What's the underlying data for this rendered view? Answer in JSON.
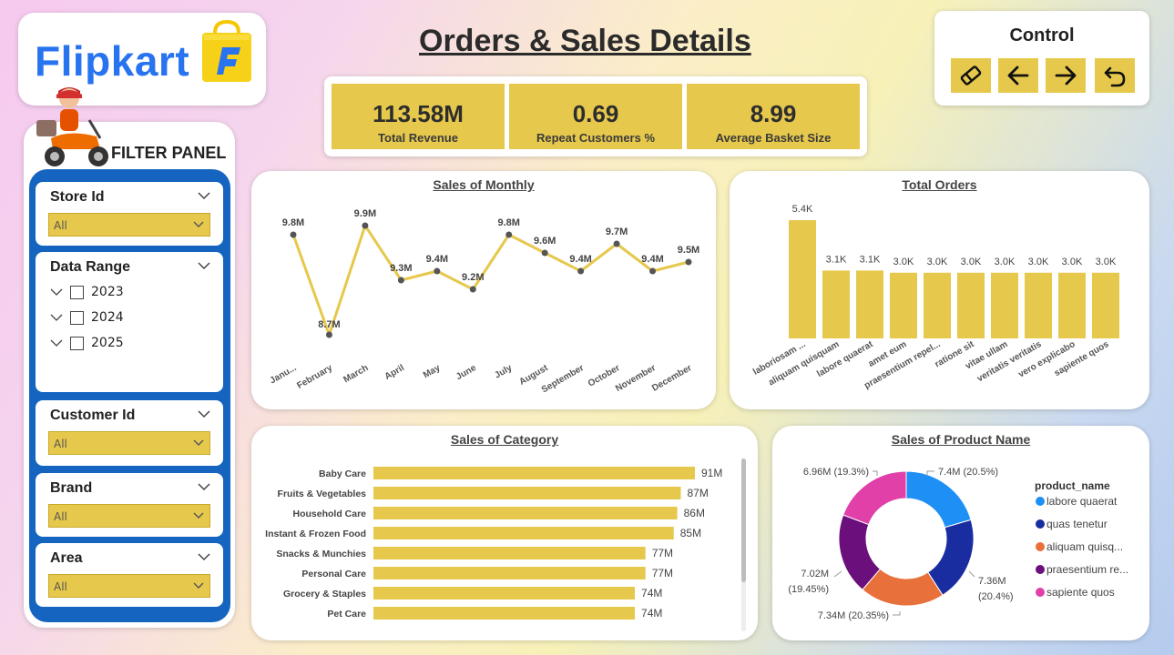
{
  "brand": {
    "name": "Flipkart"
  },
  "page_title": "Orders & Sales Details",
  "control": {
    "title": "Control",
    "buttons": [
      {
        "id": "eraser",
        "icon": "eraser-icon"
      },
      {
        "id": "back",
        "icon": "arrow-left-icon"
      },
      {
        "id": "forward",
        "icon": "arrow-right-icon"
      },
      {
        "id": "reset",
        "icon": "undo-icon"
      }
    ]
  },
  "kpis": [
    {
      "value": "113.58M",
      "label": "Total Revenue"
    },
    {
      "value": "0.69",
      "label": "Repeat Customers %"
    },
    {
      "value": "8.99",
      "label": "Average Basket Size"
    }
  ],
  "filter_panel": {
    "title": "FILTER PANEL",
    "store": {
      "title": "Store Id",
      "value": "All"
    },
    "date_range": {
      "title": "Data Range",
      "years": [
        "2023",
        "2024",
        "2025"
      ]
    },
    "customer": {
      "title": "Customer Id",
      "value": "All"
    },
    "brand": {
      "title": "Brand",
      "value": "All"
    },
    "area": {
      "title": "Area",
      "value": "All"
    }
  },
  "colors": {
    "accent": "#e6c84c",
    "panel_blue": "#1565c0",
    "bar": "#e6c84c",
    "line": "#e6c84c"
  },
  "chart_data": [
    {
      "type": "line",
      "title": "Sales of Monthly",
      "categories": [
        "Janu...",
        "February",
        "March",
        "April",
        "May",
        "June",
        "July",
        "August",
        "September",
        "October",
        "November",
        "December"
      ],
      "values": [
        9.8,
        8.7,
        9.9,
        9.3,
        9.4,
        9.2,
        9.8,
        9.6,
        9.4,
        9.7,
        9.4,
        9.5
      ],
      "labels": [
        "9.8M",
        "8.7M",
        "9.9M",
        "9.3M",
        "9.4M",
        "9.2M",
        "9.8M",
        "9.6M",
        "9.4M",
        "9.7M",
        "9.4M",
        "9.5M"
      ],
      "ylim": [
        8.5,
        10.0
      ]
    },
    {
      "type": "bar",
      "title": "Total Orders",
      "categories": [
        "laboriosam ...",
        "aliquam quisquam",
        "labore quaerat",
        "amet eum",
        "praesentium repel...",
        "ratione sit",
        "vitae ullam",
        "veritatis veritatis",
        "vero explicabo",
        "sapiente quos"
      ],
      "values": [
        5.4,
        3.1,
        3.1,
        3.0,
        3.0,
        3.0,
        3.0,
        3.0,
        3.0,
        3.0
      ],
      "labels": [
        "5.4K",
        "3.1K",
        "3.1K",
        "3.0K",
        "3.0K",
        "3.0K",
        "3.0K",
        "3.0K",
        "3.0K",
        "3.0K"
      ],
      "ylim": [
        0,
        5.4
      ]
    },
    {
      "type": "bar",
      "orientation": "horizontal",
      "title": "Sales of Category",
      "categories": [
        "Baby Care",
        "Fruits & Vegetables",
        "Household Care",
        "Instant & Frozen Food",
        "Snacks & Munchies",
        "Personal Care",
        "Grocery & Staples",
        "Pet Care"
      ],
      "values": [
        91,
        87,
        86,
        85,
        77,
        77,
        74,
        74
      ],
      "labels": [
        "91M",
        "87M",
        "86M",
        "85M",
        "77M",
        "77M",
        "74M",
        "74M"
      ],
      "xlim": [
        0,
        91
      ]
    },
    {
      "type": "pie",
      "donut": true,
      "title": "Sales of Product Name",
      "legend_title": "product_name",
      "legend_position": "right",
      "series": [
        {
          "name": "labore quaerat",
          "value": 7.4,
          "percent": 20.5,
          "label": "7.4M (20.5%)",
          "color": "#1e8ff5"
        },
        {
          "name": "quas tenetur",
          "value": 7.36,
          "percent": 20.4,
          "label": "7.36M (20.4%)",
          "color": "#1a2da0"
        },
        {
          "name": "aliquam quisq...",
          "value": 7.34,
          "percent": 20.35,
          "label": "7.34M (20.35%)",
          "color": "#e8703a"
        },
        {
          "name": "praesentium re...",
          "value": 7.02,
          "percent": 19.45,
          "label": "7.02M (19.45%)",
          "color": "#6b0f7c"
        },
        {
          "name": "sapiente quos",
          "value": 6.96,
          "percent": 19.3,
          "label": "6.96M (19.3%)",
          "color": "#e040a8"
        }
      ]
    }
  ]
}
